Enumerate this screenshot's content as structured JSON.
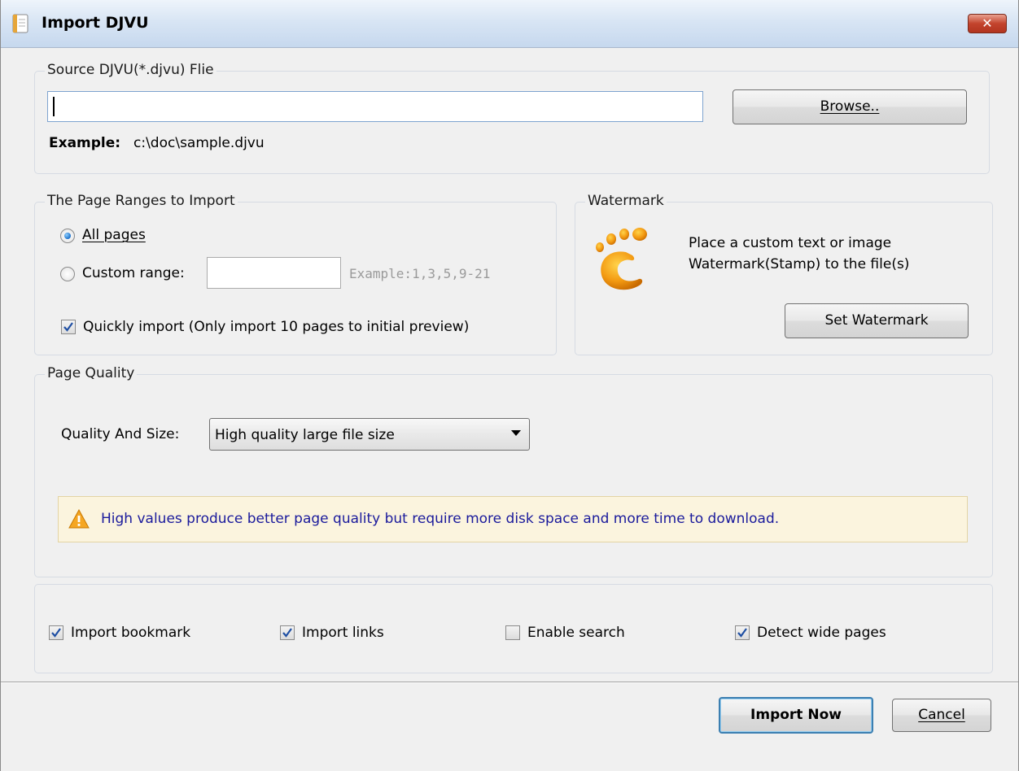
{
  "window": {
    "title": "Import DJVU",
    "close_glyph": "✕"
  },
  "source": {
    "legend": "Source DJVU(*.djvu) Flie",
    "path_value": "",
    "browse_label": "Browse..",
    "example_label": "Example:",
    "example_value": "c:\\doc\\sample.djvu"
  },
  "page_ranges": {
    "legend": "The Page Ranges to Import",
    "all_pages_label": "All pages",
    "all_pages_selected": true,
    "custom_range_label": "Custom range:",
    "custom_range_value": "",
    "custom_range_example": "Example:1,3,5,9-21",
    "quick_import_label": "Quickly import (Only import 10 pages to  initial  preview)",
    "quick_import_checked": true
  },
  "watermark": {
    "legend": "Watermark",
    "description_line1": "Place a custom text or image",
    "description_line2": "Watermark(Stamp) to the file(s)",
    "set_button_label": "Set Watermark",
    "icon": "footprint-logo-icon"
  },
  "quality": {
    "legend": "Page Quality",
    "label": "Quality And Size:",
    "selected": "High quality large file size",
    "warning": "High values produce better page quality but require more disk space and more time to download."
  },
  "options": {
    "import_bookmark": {
      "label": "Import bookmark",
      "checked": true
    },
    "import_links": {
      "label": "Import links",
      "checked": true
    },
    "enable_search": {
      "label": "Enable search",
      "checked": false
    },
    "detect_wide_pages": {
      "label": "Detect wide pages",
      "checked": true
    }
  },
  "footer": {
    "import_now_label": "Import Now",
    "cancel_label": "Cancel"
  },
  "colors": {
    "warning_text": "#1a1a9c",
    "accent": "#3c7fb1",
    "title_gradient": "#d8e5f4"
  }
}
